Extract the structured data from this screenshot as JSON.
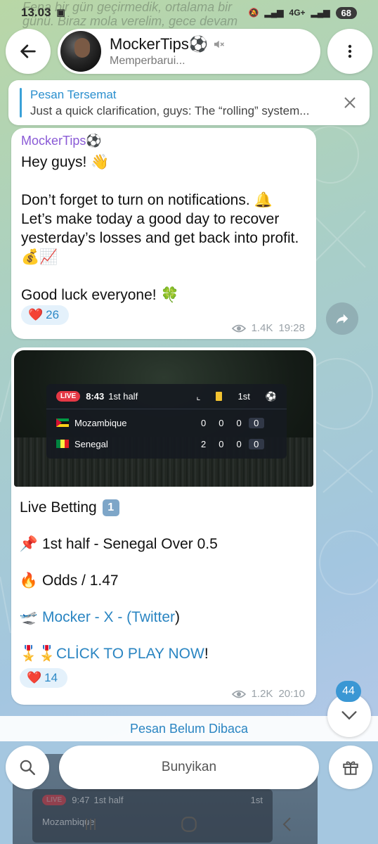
{
  "status_bar": {
    "time": "13.03",
    "network": "4G+",
    "battery": "68"
  },
  "background_text": {
    "line1": "Fena bir gün geçirmedik, ortalama bir",
    "line2": "günü. Biraz mola verelim, gece devam"
  },
  "header": {
    "channel_name": "MockerTips⚽",
    "subtitle": "Memperbarui..."
  },
  "pinned": {
    "title": "Pesan Tersemat",
    "text": "Just a quick clarification, guys:  The “rolling” system..."
  },
  "message1": {
    "sender": "MockerTips⚽",
    "greeting": "Hey guys! 👋",
    "para1": "Don’t forget to turn on notifications. 🔔 Let’s make today a good day to recover yesterday’s losses and get back into profit. 💰📈",
    "para2": "Good luck everyone! 🍀",
    "reaction_count": "26",
    "views": "1.4K",
    "time": "19:28"
  },
  "message2": {
    "scoreboard": {
      "live": "LIVE",
      "clock": "8:43",
      "period": "1st half",
      "col_label": "1st",
      "team1": {
        "name": "Mozambique",
        "s1": "0",
        "s2": "0",
        "s3": "0",
        "total": "0"
      },
      "team2": {
        "name": "Senegal",
        "s1": "2",
        "s2": "0",
        "s3": "0",
        "total": "0"
      }
    },
    "title": "Live Betting",
    "title_badge": "1",
    "pick": "1st half -  Senegal Over 0.5",
    "odds": "Odds / 1.47",
    "link_text": "Mocker - X - (Twitter",
    "link_suffix": ")",
    "cta_link": "CLİCK TO PLAY NOW",
    "cta_suffix": "!",
    "reaction_count": "14",
    "views": "1.2K",
    "time": "20:10"
  },
  "unread_bar": "Pesan Belum Dibaca",
  "unread_badge": "44",
  "bottom": {
    "mute_label": "Bunyikan",
    "ghost": {
      "live": "LIVE",
      "clock": "9:47",
      "period": "1st half",
      "col_label": "1st",
      "team": "Mozambique"
    }
  },
  "colors": {
    "accent_blue": "#2a85c2",
    "sender_purple": "#8a5ad6",
    "live_red": "#e53845"
  }
}
